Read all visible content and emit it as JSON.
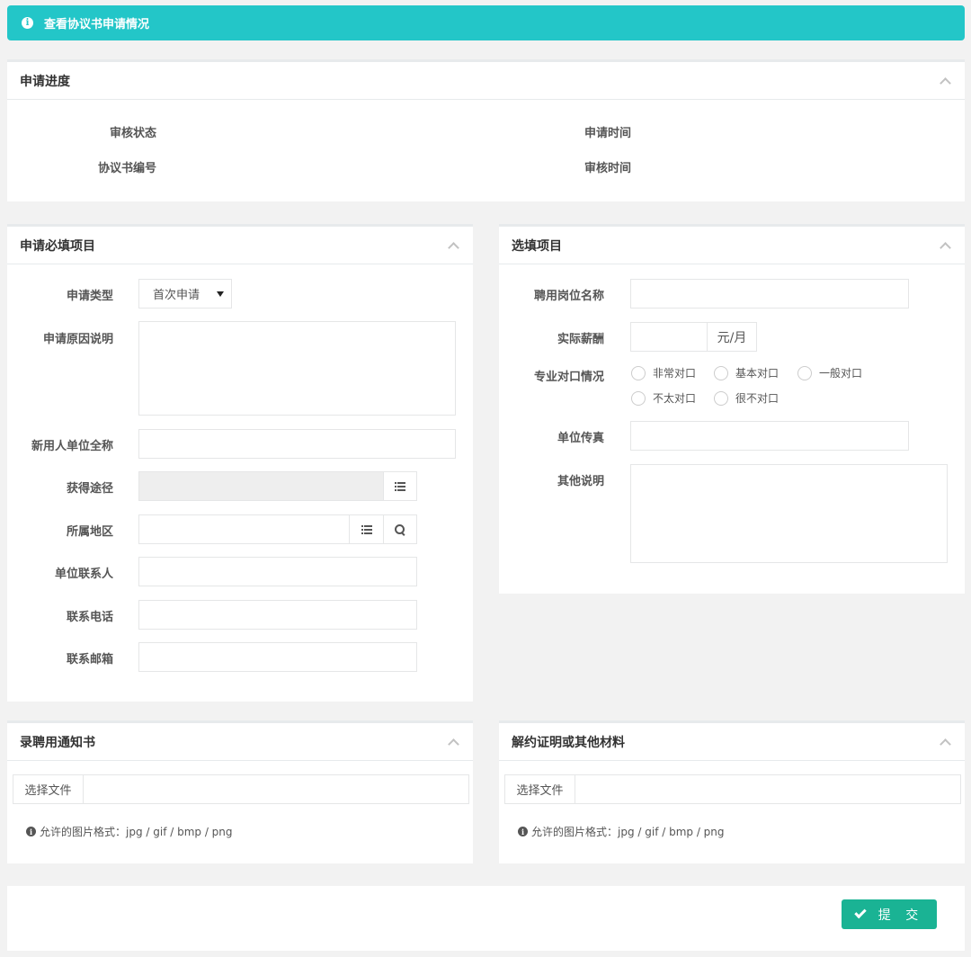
{
  "banner": {
    "text": "查看协议书申请情况"
  },
  "progress": {
    "title": "申请进度",
    "review_status_label": "审核状态",
    "apply_time_label": "申请时间",
    "agreement_no_label": "协议书编号",
    "review_time_label": "审核时间"
  },
  "required": {
    "title": "申请必填项目",
    "apply_type_label": "申请类型",
    "apply_type_value": "首次申请",
    "reason_label": "申请原因说明",
    "employer_name_label": "新用人单位全称",
    "source_label": "获得途径",
    "region_label": "所属地区",
    "contact_person_label": "单位联系人",
    "contact_phone_label": "联系电话",
    "contact_email_label": "联系邮箱"
  },
  "optional": {
    "title": "选填项目",
    "position_label": "聘用岗位名称",
    "salary_label": "实际薪酬",
    "salary_unit": "元/月",
    "match_label": "专业对口情况",
    "match_options": [
      "非常对口",
      "基本对口",
      "一般对口",
      "不太对口",
      "很不对口"
    ],
    "fax_label": "单位传真",
    "other_label": "其他说明"
  },
  "offer_letter": {
    "title": "录聘用通知书",
    "choose_file": "选择文件",
    "hint": "允许的图片格式：jpg / gif / bmp / png"
  },
  "termination": {
    "title": "解约证明或其他材料",
    "choose_file": "选择文件",
    "hint": "允许的图片格式：jpg / gif / bmp / png"
  },
  "actions": {
    "submit": "提 交"
  }
}
